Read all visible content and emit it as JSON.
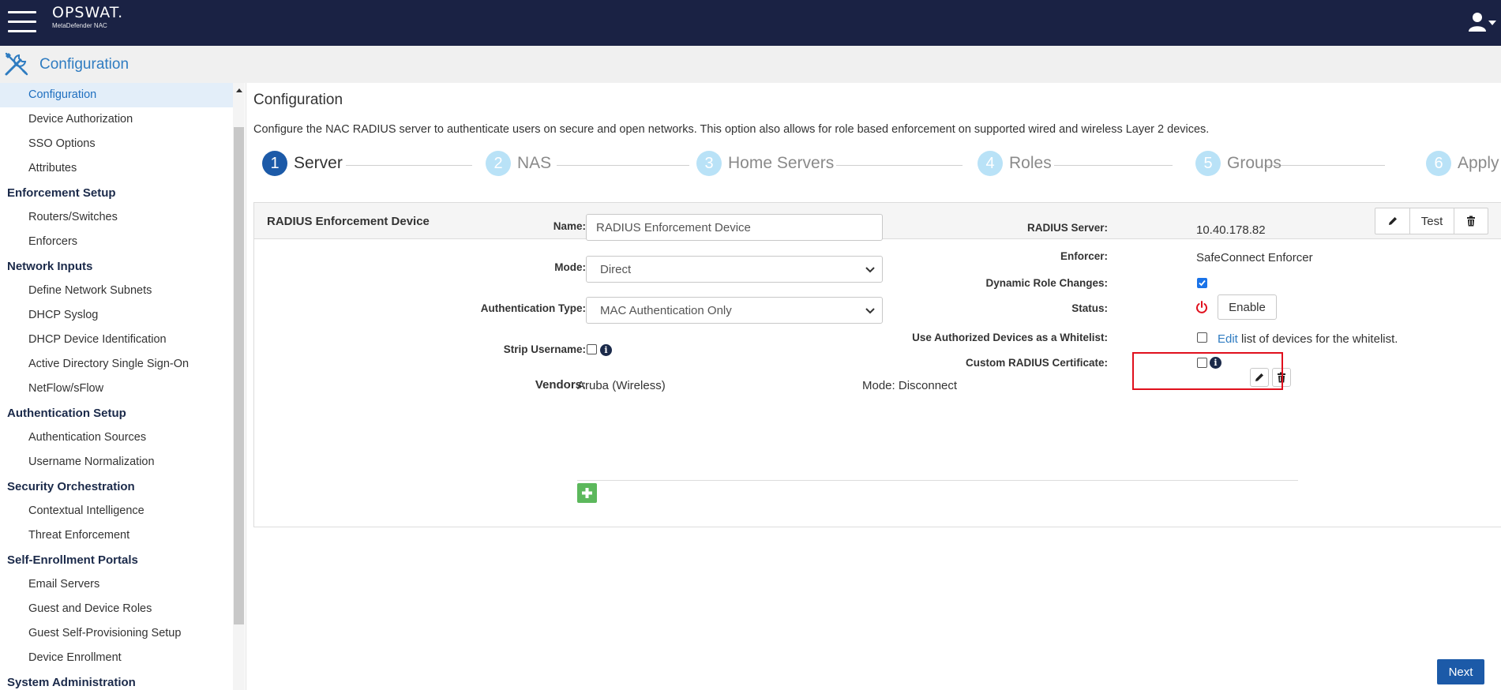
{
  "header": {
    "brand": "OPSWAT.",
    "product": "MetaDefender NAC"
  },
  "subheader": {
    "title": "Configuration"
  },
  "sidebar": {
    "items": [
      {
        "type": "item",
        "label": "Configuration",
        "active": true
      },
      {
        "type": "item",
        "label": "Device Authorization"
      },
      {
        "type": "item",
        "label": "SSO Options"
      },
      {
        "type": "item",
        "label": "Attributes"
      },
      {
        "type": "section",
        "label": "Enforcement Setup"
      },
      {
        "type": "item",
        "label": "Routers/Switches"
      },
      {
        "type": "item",
        "label": "Enforcers"
      },
      {
        "type": "section",
        "label": "Network Inputs"
      },
      {
        "type": "item",
        "label": "Define Network Subnets"
      },
      {
        "type": "item",
        "label": "DHCP Syslog"
      },
      {
        "type": "item",
        "label": "DHCP Device Identification"
      },
      {
        "type": "item",
        "label": "Active Directory Single Sign-On"
      },
      {
        "type": "item",
        "label": "NetFlow/sFlow"
      },
      {
        "type": "section",
        "label": "Authentication Setup"
      },
      {
        "type": "item",
        "label": "Authentication Sources"
      },
      {
        "type": "item",
        "label": "Username Normalization"
      },
      {
        "type": "section",
        "label": "Security Orchestration"
      },
      {
        "type": "item",
        "label": "Contextual Intelligence"
      },
      {
        "type": "item",
        "label": "Threat Enforcement"
      },
      {
        "type": "section",
        "label": "Self-Enrollment Portals"
      },
      {
        "type": "item",
        "label": "Email Servers"
      },
      {
        "type": "item",
        "label": "Guest and Device Roles"
      },
      {
        "type": "item",
        "label": "Guest Self-Provisioning Setup"
      },
      {
        "type": "item",
        "label": "Device Enrollment"
      },
      {
        "type": "section",
        "label": "System Administration"
      }
    ]
  },
  "main": {
    "title": "Configuration",
    "description": "Configure the NAC RADIUS server to authenticate users on secure and open networks. This option also allows for role based enforcement on supported wired and wireless Layer 2 devices.",
    "steps": [
      {
        "num": "1",
        "label": "Server",
        "active": true
      },
      {
        "num": "2",
        "label": "NAS"
      },
      {
        "num": "3",
        "label": "Home Servers"
      },
      {
        "num": "4",
        "label": "Roles"
      },
      {
        "num": "5",
        "label": "Groups"
      },
      {
        "num": "6",
        "label": "Apply"
      }
    ],
    "next_label": "Next"
  },
  "panel": {
    "title": "RADIUS Enforcement Device",
    "test_label": "Test",
    "name_label": "Name:",
    "name_value": "RADIUS Enforcement Device",
    "mode_label": "Mode:",
    "mode_value": "Direct",
    "auth_type_label": "Authentication Type:",
    "auth_type_value": "MAC Authentication Only",
    "strip_username_label": "Strip Username:",
    "strip_username_checked": false,
    "vendors_label": "Vendors:",
    "vendor_name": "Aruba (Wireless)",
    "vendor_mode": "Mode: Disconnect",
    "radius_server_label": "RADIUS Server:",
    "radius_server_value": "10.40.178.82",
    "enforcer_label": "Enforcer:",
    "enforcer_value": "SafeConnect Enforcer",
    "dynamic_role_label": "Dynamic Role Changes:",
    "dynamic_role_checked": true,
    "status_label": "Status:",
    "enable_label": "Enable",
    "whitelist_label": "Use Authorized Devices as a Whitelist:",
    "whitelist_checked": false,
    "whitelist_edit": "Edit",
    "whitelist_text": "list of devices for the whitelist.",
    "custom_cert_label": "Custom RADIUS Certificate:",
    "custom_cert_checked": false
  },
  "colors": {
    "header_bg": "#1a2244",
    "accent": "#1c5aa8",
    "link": "#2f7cc1",
    "step_inactive": "#b9e2f7",
    "highlight": "#e0101d",
    "power": "#e0101d",
    "add": "#5cb85c"
  }
}
